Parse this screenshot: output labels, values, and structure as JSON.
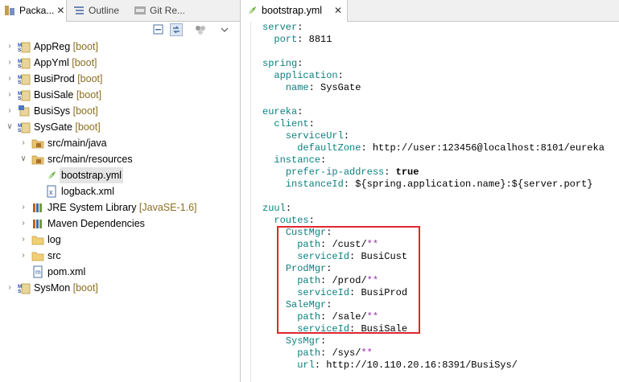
{
  "left_tabs": [
    {
      "label": "Packa...",
      "icon": "package-explorer-icon",
      "active": true
    },
    {
      "label": "Outline",
      "icon": "outline-icon",
      "active": false
    },
    {
      "label": "Git Re...",
      "icon": "git-repositories-icon",
      "active": false
    }
  ],
  "tab_close": "✕",
  "tree": [
    {
      "label": "AppReg",
      "decoration": "[boot]",
      "icon": "maven-project-icon",
      "depth": 0,
      "arrow": "collapsed"
    },
    {
      "label": "AppYml",
      "decoration": "[boot]",
      "icon": "maven-project-icon",
      "depth": 0,
      "arrow": "collapsed"
    },
    {
      "label": "BusiProd",
      "decoration": "[boot]",
      "icon": "maven-project-icon",
      "depth": 0,
      "arrow": "collapsed"
    },
    {
      "label": "BusiSale",
      "decoration": "[boot]",
      "icon": "maven-project-icon",
      "depth": 0,
      "arrow": "collapsed"
    },
    {
      "label": "BusiSys",
      "decoration": "[boot]",
      "icon": "java-project-icon",
      "depth": 0,
      "arrow": "collapsed"
    },
    {
      "label": "SysGate",
      "decoration": "[boot]",
      "icon": "maven-project-icon",
      "depth": 0,
      "arrow": "expanded"
    },
    {
      "label": "src/main/java",
      "decoration": "",
      "icon": "source-folder-icon",
      "depth": 1,
      "arrow": "collapsed"
    },
    {
      "label": "src/main/resources",
      "decoration": "",
      "icon": "source-folder-icon",
      "depth": 1,
      "arrow": "expanded"
    },
    {
      "label": "bootstrap.yml",
      "decoration": "",
      "icon": "yaml-file-icon",
      "depth": 2,
      "arrow": "none",
      "selected": true
    },
    {
      "label": "logback.xml",
      "decoration": "",
      "icon": "xml-file-icon",
      "depth": 2,
      "arrow": "none"
    },
    {
      "label": "JRE System Library",
      "decoration": "[JavaSE-1.6]",
      "icon": "library-icon",
      "depth": 1,
      "arrow": "collapsed"
    },
    {
      "label": "Maven Dependencies",
      "decoration": "",
      "icon": "library-icon",
      "depth": 1,
      "arrow": "collapsed"
    },
    {
      "label": "log",
      "decoration": "",
      "icon": "folder-icon",
      "depth": 1,
      "arrow": "collapsed"
    },
    {
      "label": "src",
      "decoration": "",
      "icon": "folder-icon",
      "depth": 1,
      "arrow": "collapsed"
    },
    {
      "label": "pom.xml",
      "decoration": "",
      "icon": "pom-file-icon",
      "depth": 1,
      "arrow": "none"
    },
    {
      "label": "SysMon",
      "decoration": "[boot]",
      "icon": "maven-project-icon",
      "depth": 0,
      "arrow": "collapsed"
    }
  ],
  "editor_tab": {
    "label": "bootstrap.yml",
    "icon": "yaml-file-icon"
  },
  "code": [
    {
      "indent": 0,
      "key": "server",
      "value": ""
    },
    {
      "indent": 1,
      "key": "port",
      "value": "8811"
    },
    {
      "blank": true
    },
    {
      "indent": 0,
      "key": "spring",
      "value": ""
    },
    {
      "indent": 1,
      "key": "application",
      "value": ""
    },
    {
      "indent": 2,
      "key": "name",
      "value": "SysGate"
    },
    {
      "blank": true
    },
    {
      "indent": 0,
      "key": "eureka",
      "value": ""
    },
    {
      "indent": 1,
      "key": "client",
      "value": ""
    },
    {
      "indent": 2,
      "key": "serviceUrl",
      "value": ""
    },
    {
      "indent": 3,
      "key": "defaultZone",
      "value": "http://user:123456@localhost:8101/eureka"
    },
    {
      "indent": 1,
      "key": "instance",
      "value": ""
    },
    {
      "indent": 2,
      "key": "prefer-ip-address",
      "value": "true",
      "bold": true
    },
    {
      "indent": 2,
      "key": "instanceId",
      "value": "${spring.application.name}:${server.port}"
    },
    {
      "blank": true
    },
    {
      "indent": 0,
      "key": "zuul",
      "value": ""
    },
    {
      "indent": 1,
      "key": "routes",
      "value": ""
    },
    {
      "indent": 2,
      "key": "CustMgr",
      "value": ""
    },
    {
      "indent": 3,
      "key": "path",
      "value": "/cust/",
      "special": "**"
    },
    {
      "indent": 3,
      "key": "serviceId",
      "value": "BusiCust"
    },
    {
      "indent": 2,
      "key": "ProdMgr",
      "value": ""
    },
    {
      "indent": 3,
      "key": "path",
      "value": "/prod/",
      "special": "**"
    },
    {
      "indent": 3,
      "key": "serviceId",
      "value": "BusiProd"
    },
    {
      "indent": 2,
      "key": "SaleMgr",
      "value": ""
    },
    {
      "indent": 3,
      "key": "path",
      "value": "/sale/",
      "special": "**"
    },
    {
      "indent": 3,
      "key": "serviceId",
      "value": "BusiSale"
    },
    {
      "indent": 2,
      "key": "SysMgr",
      "value": ""
    },
    {
      "indent": 3,
      "key": "path",
      "value": "/sys/",
      "special": "**"
    },
    {
      "indent": 3,
      "key": "url",
      "value": "http://10.110.20.16:8391/BusiSys/"
    }
  ],
  "colors": {
    "key": "#0d8080",
    "special": "#9b2fb0",
    "decoration": "#8b6d1f",
    "highlight": "#e0262f"
  }
}
